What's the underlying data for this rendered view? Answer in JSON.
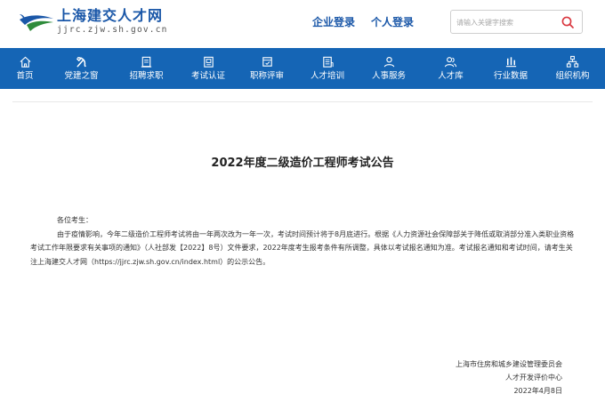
{
  "header": {
    "logo_title": "上海建交人才网",
    "logo_url": "jjrc.zjw.sh.gov.cn",
    "links": [
      "企业登录",
      "个人登录"
    ],
    "search": {
      "placeholder": "请输入关键字搜索",
      "icon": "search-icon"
    }
  },
  "nav": {
    "items": [
      {
        "label": "首页",
        "icon": "home-icon"
      },
      {
        "label": "党建之窗",
        "icon": "party-icon"
      },
      {
        "label": "招聘求职",
        "icon": "clipboard-icon"
      },
      {
        "label": "考试认证",
        "icon": "certificate-icon"
      },
      {
        "label": "职称评审",
        "icon": "review-icon"
      },
      {
        "label": "人才培训",
        "icon": "building-icon"
      },
      {
        "label": "人事服务",
        "icon": "user-icon"
      },
      {
        "label": "人才库",
        "icon": "users-icon"
      },
      {
        "label": "行业数据",
        "icon": "bar-chart-icon"
      },
      {
        "label": "组织机构",
        "icon": "org-chart-icon"
      }
    ],
    "color": "#1565b5"
  },
  "article": {
    "title": "2022年度二级造价工程师考试公告",
    "salutation": "各位考生：",
    "body": "由于疫情影响，今年二级造价工程师考试将由一年两次改为一年一次，考试时间预计将于8月底进行。根据《人力资源社会保障部关于降低或取消部分准入类职业资格考试工作年限要求有关事项的通知》（人社部发【2022】8号）文件要求，2022年度考生报考条件有所调整，具体以考试报名通知为准。考试报名通知和考试时间，请考生关注上海建交人才网（https://jjrc.zjw.sh.gov.cn/index.html）的公示公告。",
    "signature": {
      "org": "上海市住房和城乡建设管理委员会",
      "dept": "人才开发评价中心",
      "date": "2022年4月8日"
    }
  }
}
